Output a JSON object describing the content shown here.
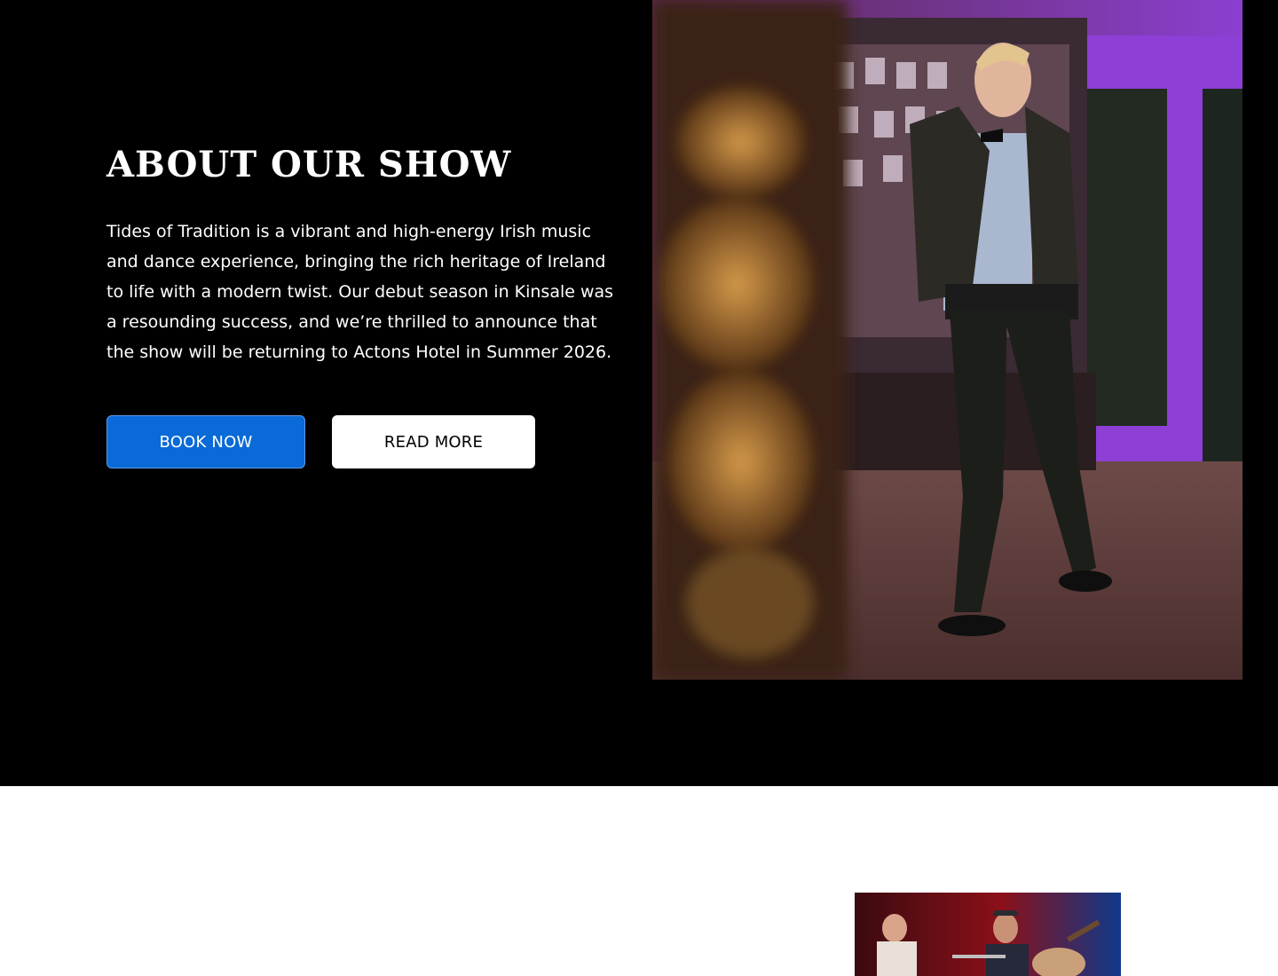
{
  "about": {
    "title": "About our show",
    "description": "Tides of Tradition is a vibrant and high-energy Irish music and dance experience, bringing the rich heritage of Ireland to life with a modern twist. Our debut season in Kinsale was a resounding success, and we’re thrilled to announce that the show will be returning to Actons Hotel in Summer 2026.",
    "book_button_label": "BOOK NOW",
    "read_button_label": "READ MORE"
  },
  "images": {
    "hero": "dancer-photo",
    "band": "band-performance-photo"
  },
  "colors": {
    "section_bg": "#000000",
    "primary_button": "#0a6ad7",
    "secondary_button": "#ffffff",
    "text": "#ffffff"
  }
}
